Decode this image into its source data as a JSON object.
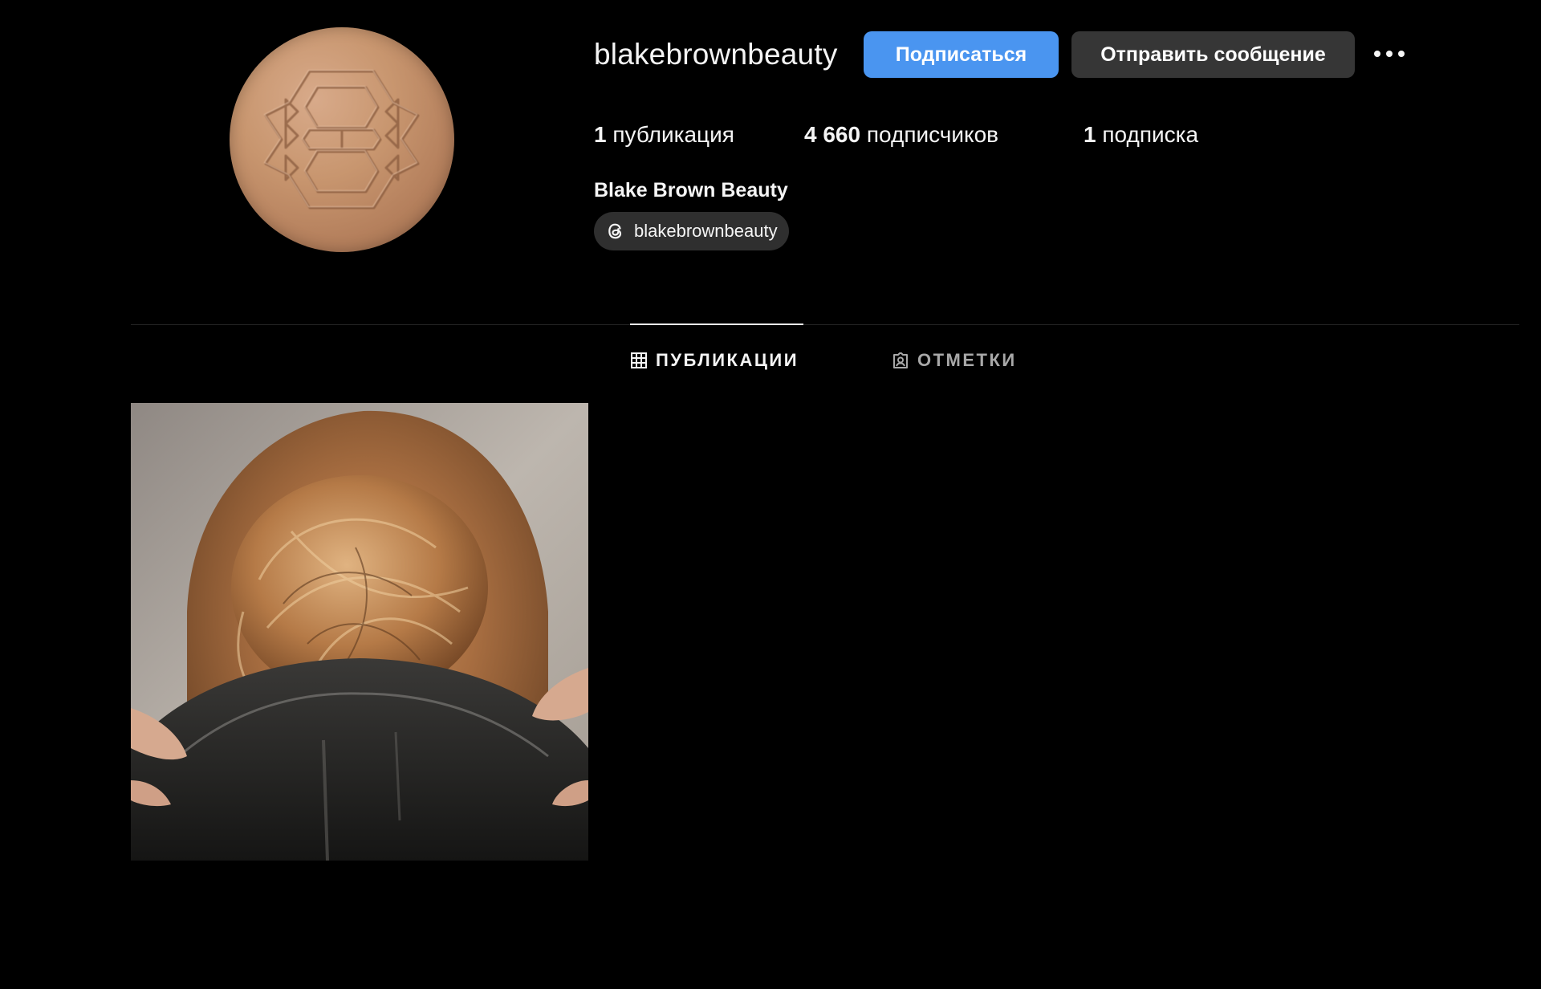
{
  "profile": {
    "username": "blakebrownbeauty",
    "full_name": "Blake Brown Beauty",
    "threads_handle": "blakebrownbeauty"
  },
  "actions": {
    "follow_label": "Подписаться",
    "message_label": "Отправить сообщение",
    "more_icon": "more-horizontal-icon"
  },
  "stats": {
    "posts_count": "1",
    "posts_label": "публикация",
    "followers_count": "4 660",
    "followers_label": "подписчиков",
    "following_count": "1",
    "following_label": "подписка"
  },
  "tabs": [
    {
      "label": "ПУБЛИКАЦИИ",
      "icon": "grid-icon",
      "active": true
    },
    {
      "label": "ОТМЕТКИ",
      "icon": "tagged-icon",
      "active": false
    }
  ],
  "colors": {
    "background": "#000000",
    "primary_button": "#4a95f0",
    "secondary_button": "#363636",
    "chip": "#2f2f2f",
    "divider": "#262626"
  }
}
